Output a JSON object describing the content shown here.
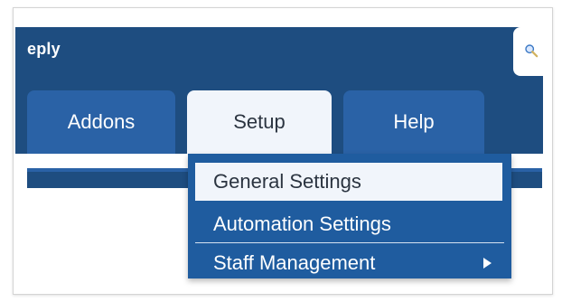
{
  "header": {
    "brand_text": "eply"
  },
  "search": {
    "icon": "search-icon"
  },
  "tabs": [
    {
      "label": "Addons",
      "active": false
    },
    {
      "label": "Setup",
      "active": true
    },
    {
      "label": "Help",
      "active": false
    }
  ],
  "setup_menu": {
    "items": [
      {
        "label": "General Settings",
        "highlighted": true
      },
      {
        "label": "Automation Settings",
        "highlighted": false
      },
      {
        "label": "Staff Management",
        "has_submenu": true,
        "submenu_icon": "chevron-right-icon"
      }
    ]
  },
  "colors": {
    "header_bg": "#1e4d80",
    "tab_bg": "#2a62a6",
    "active_bg": "#f1f5fb",
    "menu_bg": "#1f5c9f",
    "active_text": "#2b3440"
  }
}
